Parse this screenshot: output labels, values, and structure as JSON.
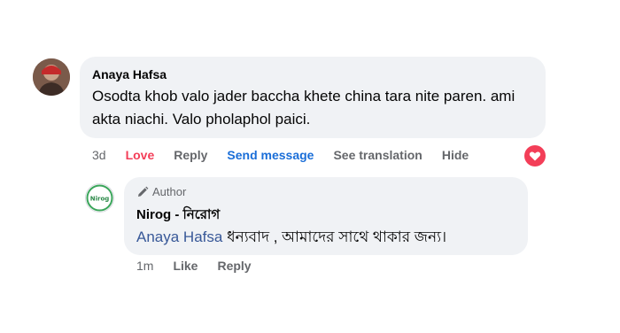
{
  "main_comment": {
    "author": "Anaya Hafsa",
    "text": "Osodta khob valo jader baccha khete china tara nite paren. ami akta niachi. Valo pholaphol paici.",
    "actions": {
      "time": "3d",
      "love": "Love",
      "reply": "Reply",
      "send_message": "Send message",
      "see_translation": "See translation",
      "hide": "Hide"
    },
    "reaction_icon": "love-reaction-icon"
  },
  "reply_comment": {
    "badge": "Author",
    "badge_icon": "pencil-icon",
    "author": "Nirog - নিরোগ",
    "mention": "Anaya Hafsa",
    "text": "ধন্যবাদ , আমাদের সাথে থাকার জন্য।",
    "avatar_text": "Nirog",
    "actions": {
      "time": "1m",
      "like": "Like",
      "reply": "Reply"
    }
  },
  "colors": {
    "bubble": "#f0f2f5",
    "love": "#f33e58",
    "link": "#1a6ed8",
    "mention": "#385898",
    "muted": "#65676b"
  }
}
